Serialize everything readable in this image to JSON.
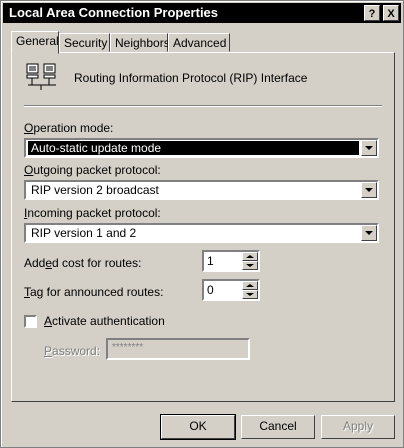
{
  "window": {
    "title": "Local Area Connection Properties",
    "help_label": "?",
    "close_label": "X"
  },
  "tabs": [
    {
      "label": "General"
    },
    {
      "label": "Security"
    },
    {
      "label": "Neighbors"
    },
    {
      "label": "Advanced"
    }
  ],
  "header": {
    "text": "Routing Information Protocol (RIP) Interface"
  },
  "fields": {
    "operation_mode": {
      "label_u": "O",
      "label_rest": "peration mode:",
      "value": "Auto-static update mode"
    },
    "outgoing": {
      "label_u": "O",
      "label_rest": "utgoing packet protocol:",
      "value": "RIP version 2 broadcast"
    },
    "incoming": {
      "label_u": "I",
      "label_rest": "ncoming packet protocol:",
      "value": "RIP version 1 and 2"
    },
    "added_cost": {
      "label_pre": "Add",
      "label_u": "e",
      "label_rest": "d cost for routes:",
      "value": "1"
    },
    "tag": {
      "label_u": "T",
      "label_rest": "ag for announced routes:",
      "value": "0"
    },
    "auth": {
      "label_u": "A",
      "label_rest": "ctivate authentication",
      "checked": false
    },
    "password": {
      "label_u": "P",
      "label_rest": "assword:",
      "value": "********"
    }
  },
  "buttons": {
    "ok": "OK",
    "cancel": "Cancel",
    "apply": "Apply"
  }
}
